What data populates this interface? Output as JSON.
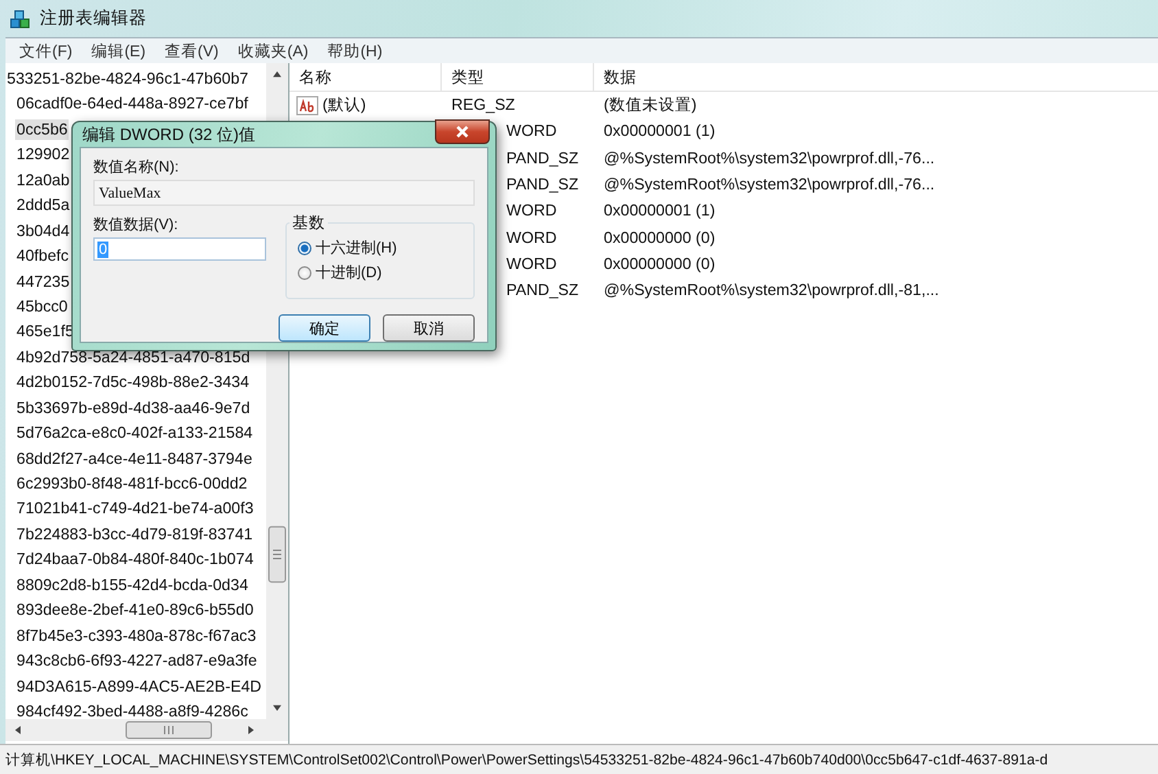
{
  "window": {
    "title": "注册表编辑器"
  },
  "menu": [
    "文件(F)",
    "编辑(E)",
    "查看(V)",
    "收藏夹(A)",
    "帮助(H)"
  ],
  "tree": [
    {
      "label": "533251-82be-4824-96c1-47b60b7",
      "selected": false,
      "children": [
        {
          "label": "06cadf0e-64ed-448a-8927-ce7bf",
          "selected": false
        },
        {
          "label": "0cc5b6",
          "selected": true
        },
        {
          "label": "129902",
          "selected": false
        },
        {
          "label": "12a0ab",
          "selected": false
        },
        {
          "label": "2ddd5a",
          "selected": false
        },
        {
          "label": "3b04d4",
          "selected": false
        },
        {
          "label": "40fbefc",
          "selected": false
        },
        {
          "label": "447235",
          "selected": false
        },
        {
          "label": "45bcc0",
          "selected": false
        },
        {
          "label": "465e1f5",
          "selected": false
        },
        {
          "label": "4b92d758-5a24-4851-a470-815d",
          "selected": false
        },
        {
          "label": "4d2b0152-7d5c-498b-88e2-3434",
          "selected": false
        },
        {
          "label": "5b33697b-e89d-4d38-aa46-9e7d",
          "selected": false
        },
        {
          "label": "5d76a2ca-e8c0-402f-a133-21584",
          "selected": false
        },
        {
          "label": "68dd2f27-a4ce-4e11-8487-3794e",
          "selected": false
        },
        {
          "label": "6c2993b0-8f48-481f-bcc6-00dd2",
          "selected": false
        },
        {
          "label": "71021b41-c749-4d21-be74-a00f3",
          "selected": false
        },
        {
          "label": "7b224883-b3cc-4d79-819f-83741",
          "selected": false
        },
        {
          "label": "7d24baa7-0b84-480f-840c-1b074",
          "selected": false
        },
        {
          "label": "8809c2d8-b155-42d4-bcda-0d34",
          "selected": false
        },
        {
          "label": "893dee8e-2bef-41e0-89c6-b55d0",
          "selected": false
        },
        {
          "label": "8f7b45e3-c393-480a-878c-f67ac3",
          "selected": false
        },
        {
          "label": "943c8cb6-6f93-4227-ad87-e9a3fe",
          "selected": false
        },
        {
          "label": "94D3A615-A899-4AC5-AE2B-E4D",
          "selected": false
        },
        {
          "label": "984cf492-3bed-4488-a8f9-4286c",
          "selected": false
        }
      ]
    }
  ],
  "table": {
    "columns": [
      "名称",
      "类型",
      "数据"
    ],
    "rows": [
      {
        "covered": false,
        "name": "(默认)",
        "type": "REG_SZ",
        "data": "(数值未设置)"
      },
      {
        "covered": true,
        "type": "WORD",
        "data": "0x00000001 (1)"
      },
      {
        "covered": true,
        "type": "PAND_SZ",
        "data": "@%SystemRoot%\\system32\\powrprof.dll,-76..."
      },
      {
        "covered": true,
        "type": "PAND_SZ",
        "data": "@%SystemRoot%\\system32\\powrprof.dll,-76..."
      },
      {
        "covered": true,
        "type": "WORD",
        "data": "0x00000001 (1)"
      },
      {
        "covered": true,
        "type": "WORD",
        "data": "0x00000000 (0)"
      },
      {
        "covered": true,
        "type": "WORD",
        "data": "0x00000000 (0)"
      },
      {
        "covered": true,
        "type": "PAND_SZ",
        "data": "@%SystemRoot%\\system32\\powrprof.dll,-81,..."
      }
    ]
  },
  "status_bar": "计算机\\HKEY_LOCAL_MACHINE\\SYSTEM\\ControlSet002\\Control\\Power\\PowerSettings\\54533251-82be-4824-96c1-47b60b740d00\\0cc5b647-c1df-4637-891a-d",
  "dialog": {
    "title": "编辑 DWORD (32 位)值",
    "name_label": "数值名称(N):",
    "name_value": "ValueMax",
    "data_label": "数值数据(V):",
    "data_value": "0",
    "base_label": "基数",
    "radios": [
      {
        "label": "十六进制(H)",
        "selected": true
      },
      {
        "label": "十进制(D)",
        "selected": false
      }
    ],
    "buttons": [
      {
        "label": "确定",
        "default": true
      },
      {
        "label": "取消",
        "default": false
      }
    ]
  }
}
